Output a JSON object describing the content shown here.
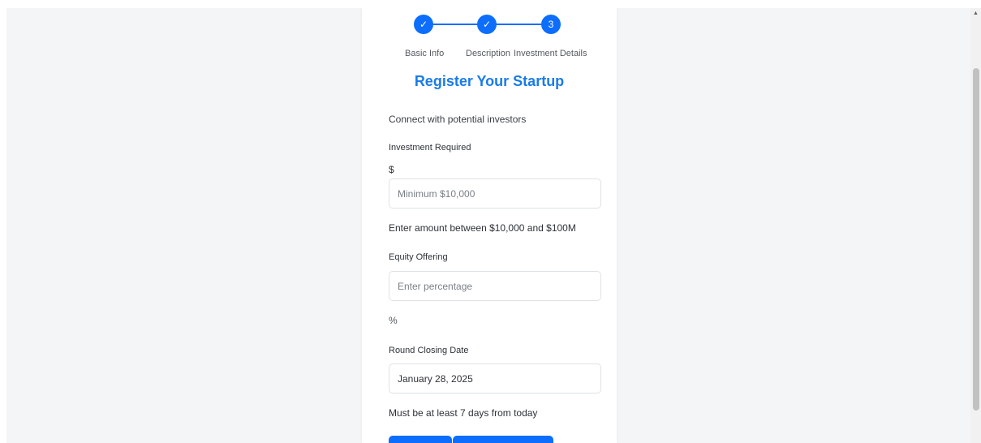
{
  "stepper": {
    "steps": [
      {
        "label": "Basic Info",
        "marker": "✓",
        "status": "completed"
      },
      {
        "label": "Description",
        "marker": "✓",
        "status": "completed"
      },
      {
        "label": "Investment Details",
        "marker": "3",
        "status": "current"
      }
    ]
  },
  "form": {
    "title": "Register Your Startup",
    "subtitle": "Connect with potential investors",
    "investment": {
      "label": "Investment Required",
      "prefix": "$",
      "placeholder": "Minimum $10,000",
      "helper": "Enter amount between $10,000 and $100M"
    },
    "equity": {
      "label": "Equity Offering",
      "placeholder": "Enter percentage",
      "suffix": "%"
    },
    "closing_date": {
      "label": "Round Closing Date",
      "value": "January 28, 2025",
      "helper": "Must be at least 7 days from today"
    }
  },
  "colors": {
    "accent": "#0d6efd",
    "title": "#1a7be8",
    "page_background": "#f4f5f7"
  },
  "icons": {
    "completed_step": "check-icon",
    "scroll_up": "triangle-up-icon"
  }
}
